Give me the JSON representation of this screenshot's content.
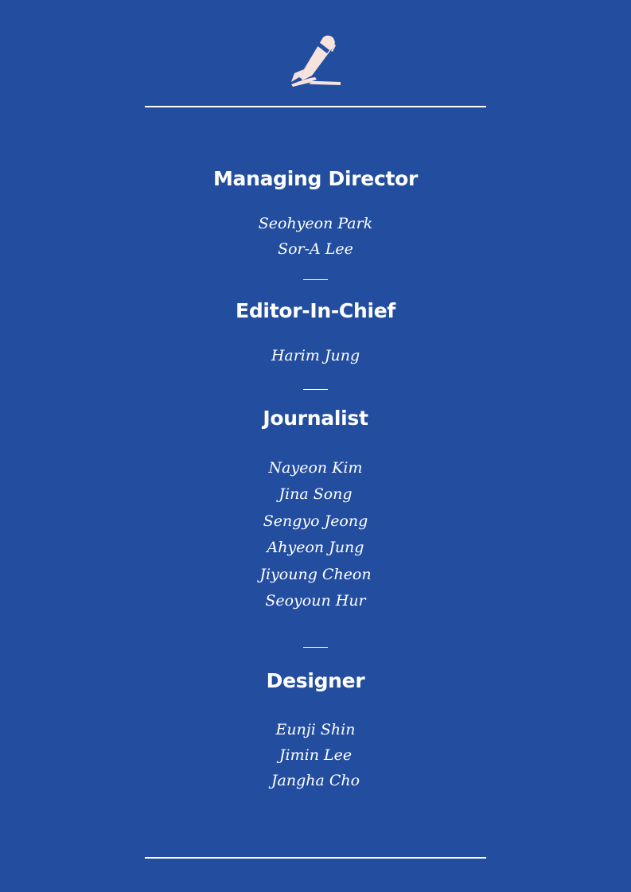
{
  "sections": [
    {
      "title": "Managing Director",
      "names": [
        "Seohyeon Park",
        "Sor-A Lee"
      ]
    },
    {
      "title": "Editor-In-Chief",
      "names": [
        "Harim Jung"
      ]
    },
    {
      "title": "Journalist",
      "names": [
        "Nayeon Kim",
        "Jina Song",
        "Sengyo Jeong",
        "Ahyeon Jung",
        "Jiyoung Cheon",
        "Seoyoun Hur"
      ]
    },
    {
      "title": "Designer",
      "names": [
        "Eunji Shin",
        "Jimin Lee",
        "Jangha Cho"
      ]
    }
  ],
  "icons": {
    "header": "pen-writing-icon"
  },
  "colors": {
    "background": "#234ea0",
    "text": "#ffffff",
    "icon": "#f7e3de"
  }
}
